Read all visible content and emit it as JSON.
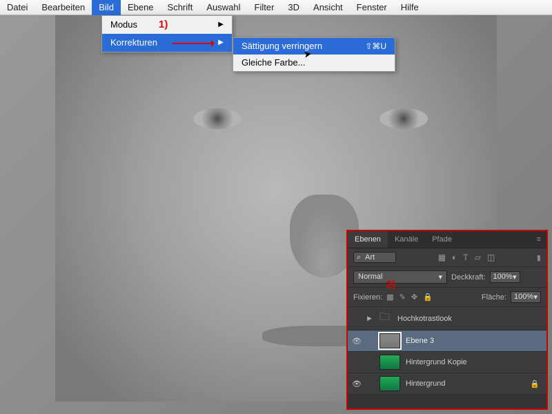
{
  "menubar": [
    "Datei",
    "Bearbeiten",
    "Bild",
    "Ebene",
    "Schrift",
    "Auswahl",
    "Filter",
    "3D",
    "Ansicht",
    "Fenster",
    "Hilfe"
  ],
  "menubar_active_index": 2,
  "menu1": {
    "items": [
      {
        "label": "Modus",
        "arrow": true
      },
      {
        "label": "Korrekturen",
        "arrow": true,
        "highlight": true
      }
    ]
  },
  "menu2": {
    "items": [
      {
        "label": "Sättigung verringern",
        "shortcut": "⇧⌘U",
        "highlight": true
      },
      {
        "label": "Gleiche Farbe...",
        "shortcut": ""
      }
    ]
  },
  "annotations": {
    "a1": "1)",
    "a2": "2)"
  },
  "panel": {
    "tabs": [
      "Ebenen",
      "Kanäle",
      "Pfade"
    ],
    "active_tab": 0,
    "filter_label": "Art",
    "blend_mode": "Normal",
    "opacity_label": "Deckkraft:",
    "opacity_value": "100%",
    "lock_label": "Fixieren:",
    "fill_label": "Fläche:",
    "fill_value": "100%",
    "layers": [
      {
        "eye": false,
        "twist": "▶",
        "folder": true,
        "name": "Hochkotrastlook"
      },
      {
        "eye": true,
        "twist": "",
        "folder": false,
        "name": "Ebene 3",
        "selected": true,
        "thumb": "g1"
      },
      {
        "eye": false,
        "twist": "",
        "folder": false,
        "name": "Hintergrund Kopie",
        "thumb": "g2"
      },
      {
        "eye": true,
        "twist": "",
        "folder": false,
        "name": "Hintergrund",
        "thumb": "g2",
        "locked": true
      }
    ]
  }
}
